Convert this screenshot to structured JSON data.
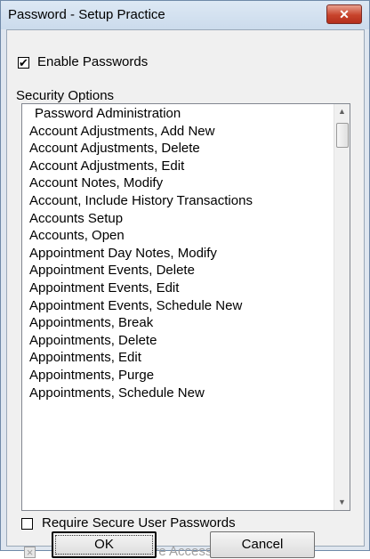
{
  "window": {
    "title": "Password - Setup Practice",
    "close_glyph": "✕"
  },
  "enable_passwords": {
    "label": "Enable Passwords",
    "checked": true,
    "mark": "✔"
  },
  "security_options": {
    "label": "Security Options",
    "items": [
      "Password Administration",
      "Account Adjustments, Add New",
      "Account Adjustments, Delete",
      "Account Adjustments, Edit",
      "Account Notes, Modify",
      "Account, Include History Transactions",
      "Accounts Setup",
      "Accounts, Open",
      "Appointment Day Notes, Modify",
      "Appointment Events, Delete",
      "Appointment Events, Edit",
      "Appointment Events, Schedule New",
      "Appointments, Break",
      "Appointments, Delete",
      "Appointments, Edit",
      "Appointments, Purge",
      "Appointments, Schedule New"
    ],
    "scroll_up_icon": "▲",
    "scroll_down_icon": "▼"
  },
  "require_secure": {
    "label": "Require Secure User Passwords",
    "checked": false
  },
  "verify_user": {
    "label": "Verify User Before Access",
    "checked": false,
    "disabled": true,
    "mark": "×"
  },
  "buttons": {
    "ok": "OK",
    "cancel": "Cancel"
  }
}
